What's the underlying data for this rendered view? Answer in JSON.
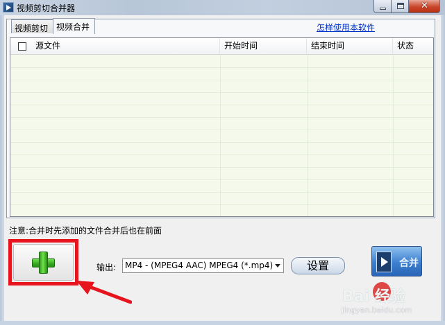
{
  "window": {
    "title": "视频剪切合并器"
  },
  "tabs": [
    {
      "label": "视频剪切"
    },
    {
      "label": "视频合并"
    }
  ],
  "help_link": "怎样使用本软件",
  "list": {
    "columns": [
      "源文件",
      "开始时间",
      "结束时间",
      "状态"
    ],
    "rows": []
  },
  "note": "注意:合并时先添加的文件合并后也在前面",
  "output": {
    "label": "输出:",
    "selected": "MP4 - (MPEG4 AAC) MPEG4 (*.mp4)"
  },
  "buttons": {
    "settings": "设置",
    "merge": "合并"
  },
  "watermark": {
    "brand": "Bai  经验",
    "url": "jingyan.baidu.com"
  },
  "colors": {
    "highlight": "#e8141d",
    "add_plus": "#35a81f",
    "merge_button": "#3b7fcf",
    "list_background": "#f4f9ec"
  },
  "icons": [
    "app-icon",
    "minimize-icon",
    "maximize-icon",
    "close-icon",
    "plus-icon",
    "dropdown-arrow-icon",
    "film-icon",
    "baidu-paw-icon"
  ]
}
